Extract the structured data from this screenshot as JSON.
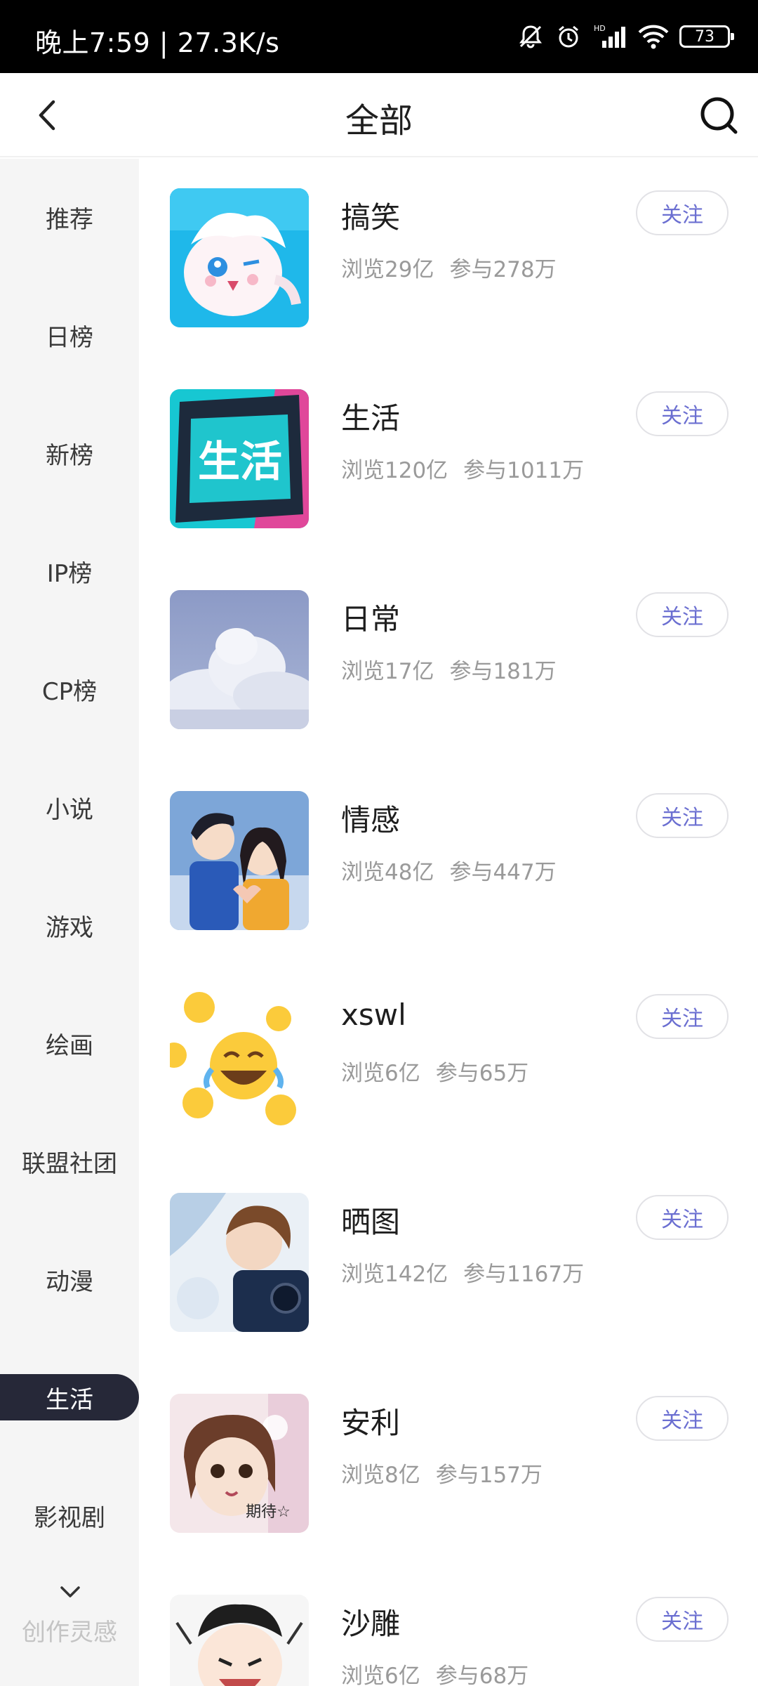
{
  "status_bar": {
    "time": "晚上7:59 | 27.3K/s",
    "battery": "73",
    "icons": [
      "bell-off-icon",
      "alarm-icon",
      "signal-icon",
      "wifi-icon",
      "battery-icon"
    ]
  },
  "header": {
    "title": "全部",
    "back_icon": "chevron-left-icon",
    "search_icon": "search-icon"
  },
  "sidebar": {
    "items": [
      {
        "label": "推荐"
      },
      {
        "label": "日榜"
      },
      {
        "label": "新榜"
      },
      {
        "label": "IP榜"
      },
      {
        "label": "CP榜"
      },
      {
        "label": "小说"
      },
      {
        "label": "游戏"
      },
      {
        "label": "绘画"
      },
      {
        "label": "联盟社团"
      },
      {
        "label": "动漫"
      },
      {
        "label": "生活"
      },
      {
        "label": "影视剧"
      }
    ],
    "active_label": "生活",
    "more_label": "创作灵感"
  },
  "topics": [
    {
      "name": "搞笑",
      "views": "浏览29亿",
      "participants": "参与278万",
      "follow_label": "关注"
    },
    {
      "name": "生活",
      "views": "浏览120亿",
      "participants": "参与1011万",
      "follow_label": "关注",
      "thumb_text": "生活"
    },
    {
      "name": "日常",
      "views": "浏览17亿",
      "participants": "参与181万",
      "follow_label": "关注"
    },
    {
      "name": "情感",
      "views": "浏览48亿",
      "participants": "参与447万",
      "follow_label": "关注"
    },
    {
      "name": "xswl",
      "views": "浏览6亿",
      "participants": "参与65万",
      "follow_label": "关注"
    },
    {
      "name": "晒图",
      "views": "浏览142亿",
      "participants": "参与1167万",
      "follow_label": "关注"
    },
    {
      "name": "安利",
      "views": "浏览8亿",
      "participants": "参与157万",
      "follow_label": "关注",
      "thumb_text": "期待☆"
    },
    {
      "name": "沙雕",
      "views": "浏览6亿",
      "participants": "参与68万",
      "follow_label": "关注"
    }
  ],
  "colors": {
    "accent": "#6b6fd1",
    "active_tab_bg": "#262838",
    "sidebar_bg": "#f5f5f5"
  }
}
